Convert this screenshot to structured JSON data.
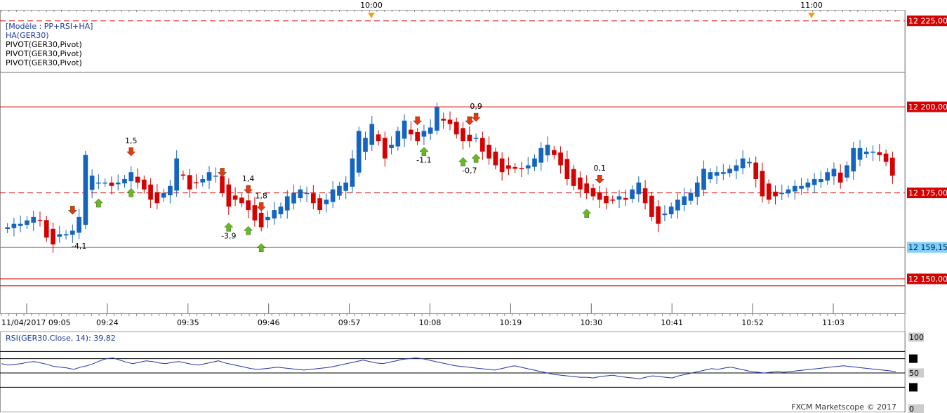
{
  "window": {
    "footer": "FXCM Marketscope © 2017"
  },
  "legend": {
    "lines": [
      {
        "text": "[Modèle : PP+RSI+HA]",
        "color": "blue"
      },
      {
        "text": "HA(GER30)",
        "color": "blue"
      },
      {
        "text": "PIVOT(GER30,Pivot)",
        "color": "black"
      },
      {
        "text": "PIVOT(GER30,Pivot)",
        "color": "black"
      },
      {
        "text": "PIVOT(GER30,Pivot)",
        "color": "black"
      }
    ]
  },
  "colors": {
    "up": "#1565c0",
    "down": "#d50000",
    "pivot": "#d50000",
    "grid": "#b0b0b0",
    "rsi_line": "#2233aa",
    "current_price_bg": "#7fd0ff",
    "price_tag_bg": "#d50000",
    "arrow_up": "#66bb22",
    "arrow_down": "#ee3311",
    "session_marker": "#f0a020"
  },
  "chart_data": [
    {
      "type": "candlestick",
      "symbol": "GER30",
      "ylim": [
        12140,
        12228
      ],
      "price_axis_labels": [
        {
          "value": 12225,
          "text": "12 225,00",
          "style": "red"
        },
        {
          "value": 12200,
          "text": "12 200,00",
          "style": "red"
        },
        {
          "value": 12175,
          "text": "12 175,00",
          "style": "red"
        },
        {
          "value": 12159.15,
          "text": "12 159,15",
          "style": "current"
        },
        {
          "value": 12150,
          "text": "12 150,00",
          "style": "red"
        }
      ],
      "pivot_levels": [
        {
          "value": 12225,
          "style": "dashed"
        },
        {
          "value": 12200,
          "style": "solid"
        },
        {
          "value": 12175,
          "style": "dashed"
        },
        {
          "value": 12150,
          "style": "solid"
        },
        {
          "value": 12148,
          "style": "solid"
        }
      ],
      "gray_levels": [
        12210,
        12159.15
      ],
      "time_labels": [
        "11/04/2017 09:05",
        "09:24",
        "09:35",
        "09:46",
        "09:57",
        "10:08",
        "10:19",
        "10:30",
        "10:41",
        "10:52",
        "11:03"
      ],
      "session_labels": [
        "10:00",
        "11:00"
      ],
      "closes": [
        12165,
        12166,
        12166,
        12167,
        12168,
        12167,
        12162,
        12160,
        12163,
        12163,
        12164,
        12168,
        12186,
        12180,
        12178,
        12178,
        12177,
        12178,
        12179,
        12181,
        12178,
        12176,
        12173,
        12172,
        12175,
        12177,
        12185,
        12180,
        12176,
        12178,
        12179,
        12181,
        12180,
        12175,
        12171,
        12173,
        12172,
        12170,
        12167,
        12165,
        12168,
        12170,
        12171,
        12174,
        12175,
        12176,
        12175,
        12172,
        12170,
        12173,
        12176,
        12177,
        12178,
        12185,
        12193,
        12191,
        12195,
        12190,
        12185,
        12189,
        12193,
        12196,
        12192,
        12190,
        12193,
        12194,
        12200,
        12196,
        12195,
        12192,
        12190,
        12190,
        12191,
        12187,
        12185,
        12183,
        12181,
        12182,
        12182,
        12182,
        12183,
        12185,
        12188,
        12189,
        12186,
        12183,
        12179,
        12177,
        12176,
        12175,
        12174,
        12173,
        12172,
        12173,
        12174,
        12173,
        12176,
        12178,
        12172,
        12168,
        12166,
        12169,
        12171,
        12173,
        12174,
        12175,
        12178,
        12182,
        12181,
        12181,
        12181,
        12182,
        12183,
        12185,
        12184,
        12179,
        12174,
        12173,
        12174,
        12175,
        12176,
        12177,
        12177,
        12178,
        12179,
        12179,
        12181,
        12182,
        12178,
        12183,
        12188,
        12188,
        12187,
        12187,
        12186,
        12184,
        12180
      ]
    },
    {
      "type": "line",
      "title": "RSI(GER30.Close, 14): 39,82",
      "ylim": [
        0,
        100
      ],
      "levels": [
        80,
        70,
        50,
        30
      ],
      "axis_labels": [
        {
          "value": 100,
          "text": "100"
        },
        {
          "value": 50,
          "text": "50"
        },
        {
          "value": 0,
          "text": "0"
        }
      ],
      "values": [
        63,
        61,
        62,
        63,
        65,
        66,
        64,
        62,
        59,
        58,
        57,
        55,
        58,
        60,
        63,
        67,
        70,
        71,
        68,
        65,
        63,
        65,
        67,
        66,
        64,
        63,
        65,
        66,
        64,
        62,
        61,
        63,
        65,
        67,
        64,
        62,
        60,
        58,
        56,
        55,
        56,
        57,
        58,
        57,
        56,
        55,
        54,
        55,
        56,
        57,
        58,
        60,
        62,
        64,
        66,
        68,
        66,
        64,
        63,
        65,
        67,
        69,
        70,
        71,
        70,
        68,
        66,
        64,
        62,
        60,
        59,
        58,
        57,
        56,
        55,
        54,
        56,
        58,
        60,
        58,
        56,
        54,
        52,
        50,
        48,
        47,
        46,
        45,
        44,
        44,
        43,
        45,
        46,
        47,
        45,
        44,
        43,
        42,
        44,
        46,
        45,
        44,
        43,
        46,
        48,
        50,
        52,
        54,
        56,
        55,
        57,
        58,
        56,
        54,
        52,
        51,
        50,
        51,
        52,
        51,
        52,
        53,
        54,
        55,
        56,
        57,
        58,
        59,
        60,
        59,
        58,
        57,
        56,
        55,
        54,
        53,
        52
      ]
    },
    {
      "type": "annotations",
      "labels": [
        {
          "i": 11,
          "text": "-4,1"
        },
        {
          "i": 19,
          "text": "1,5"
        },
        {
          "i": 34,
          "text": "-3,9"
        },
        {
          "i": 37,
          "text": "1,4"
        },
        {
          "i": 39,
          "text": "1,8"
        },
        {
          "i": 64,
          "text": "-1,1"
        },
        {
          "i": 71,
          "text": "-0,7"
        },
        {
          "i": 72,
          "text": "0,9"
        },
        {
          "i": 91,
          "text": "0,1"
        }
      ],
      "arrows": [
        {
          "i": 10,
          "dir": "down",
          "pos": "above"
        },
        {
          "i": 14,
          "dir": "up",
          "pos": "below"
        },
        {
          "i": 19,
          "dir": "down",
          "pos": "above"
        },
        {
          "i": 19,
          "dir": "up",
          "pos": "below"
        },
        {
          "i": 33,
          "dir": "down",
          "pos": "above"
        },
        {
          "i": 34,
          "dir": "up",
          "pos": "below"
        },
        {
          "i": 37,
          "dir": "down",
          "pos": "above"
        },
        {
          "i": 37,
          "dir": "up",
          "pos": "below"
        },
        {
          "i": 39,
          "dir": "down",
          "pos": "above"
        },
        {
          "i": 39,
          "dir": "up",
          "pos": "below"
        },
        {
          "i": 63,
          "dir": "down",
          "pos": "above"
        },
        {
          "i": 64,
          "dir": "up",
          "pos": "below"
        },
        {
          "i": 70,
          "dir": "up",
          "pos": "below"
        },
        {
          "i": 71,
          "dir": "down",
          "pos": "above"
        },
        {
          "i": 72,
          "dir": "down",
          "pos": "above"
        },
        {
          "i": 72,
          "dir": "up",
          "pos": "below"
        },
        {
          "i": 89,
          "dir": "up",
          "pos": "below"
        },
        {
          "i": 91,
          "dir": "down",
          "pos": "above"
        }
      ]
    }
  ]
}
